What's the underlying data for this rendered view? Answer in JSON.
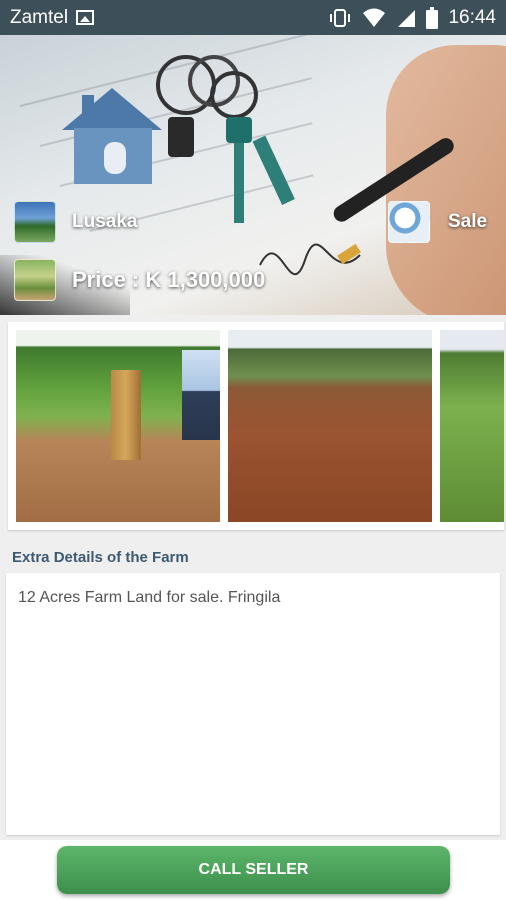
{
  "status_bar": {
    "carrier": "Zamtel",
    "time": "16:44",
    "icons": [
      "image-icon",
      "vibrate-icon",
      "wifi-icon",
      "signal-icon",
      "battery-icon"
    ]
  },
  "hero": {
    "location": "Lusaka",
    "listing_type": "Sale",
    "price": "Price :  K 1,300,000"
  },
  "gallery": {
    "photos": [
      "water-pump-photo",
      "red-soil-field-photo",
      "grass-field-photo"
    ]
  },
  "details": {
    "title": "Extra Details of the Farm",
    "text": "12 Acres Farm Land for sale. Fringila"
  },
  "actions": {
    "call_label": "CALL SELLER"
  },
  "colors": {
    "status_bar": "#3d4f58",
    "details_title": "#3d5a72",
    "button_green": "#4aa35a"
  }
}
